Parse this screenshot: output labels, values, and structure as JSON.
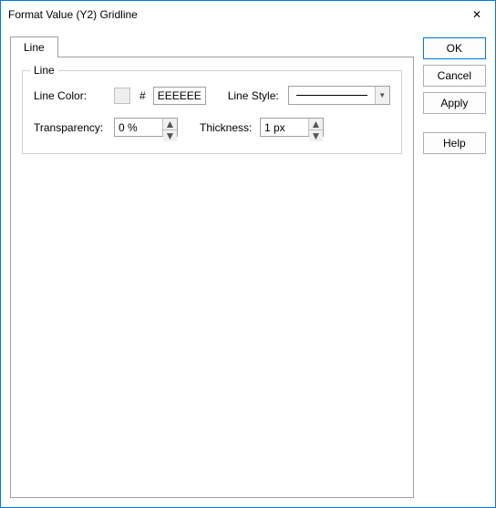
{
  "title": "Format Value (Y2) Gridline",
  "tabs": {
    "line": "Line"
  },
  "group": {
    "title": "Line",
    "lineColorLabel": "Line Color:",
    "hash": "#",
    "hexValue": "EEEEEE",
    "swatchColor": "#EEEEEE",
    "lineStyleLabel": "Line Style:",
    "transparencyLabel": "Transparency:",
    "transparencyValue": "0 %",
    "thicknessLabel": "Thickness:",
    "thicknessValue": "1 px"
  },
  "buttons": {
    "ok": "OK",
    "cancel": "Cancel",
    "apply": "Apply",
    "help": "Help"
  },
  "glyphs": {
    "close": "✕",
    "up": "▲",
    "down": "▼"
  }
}
